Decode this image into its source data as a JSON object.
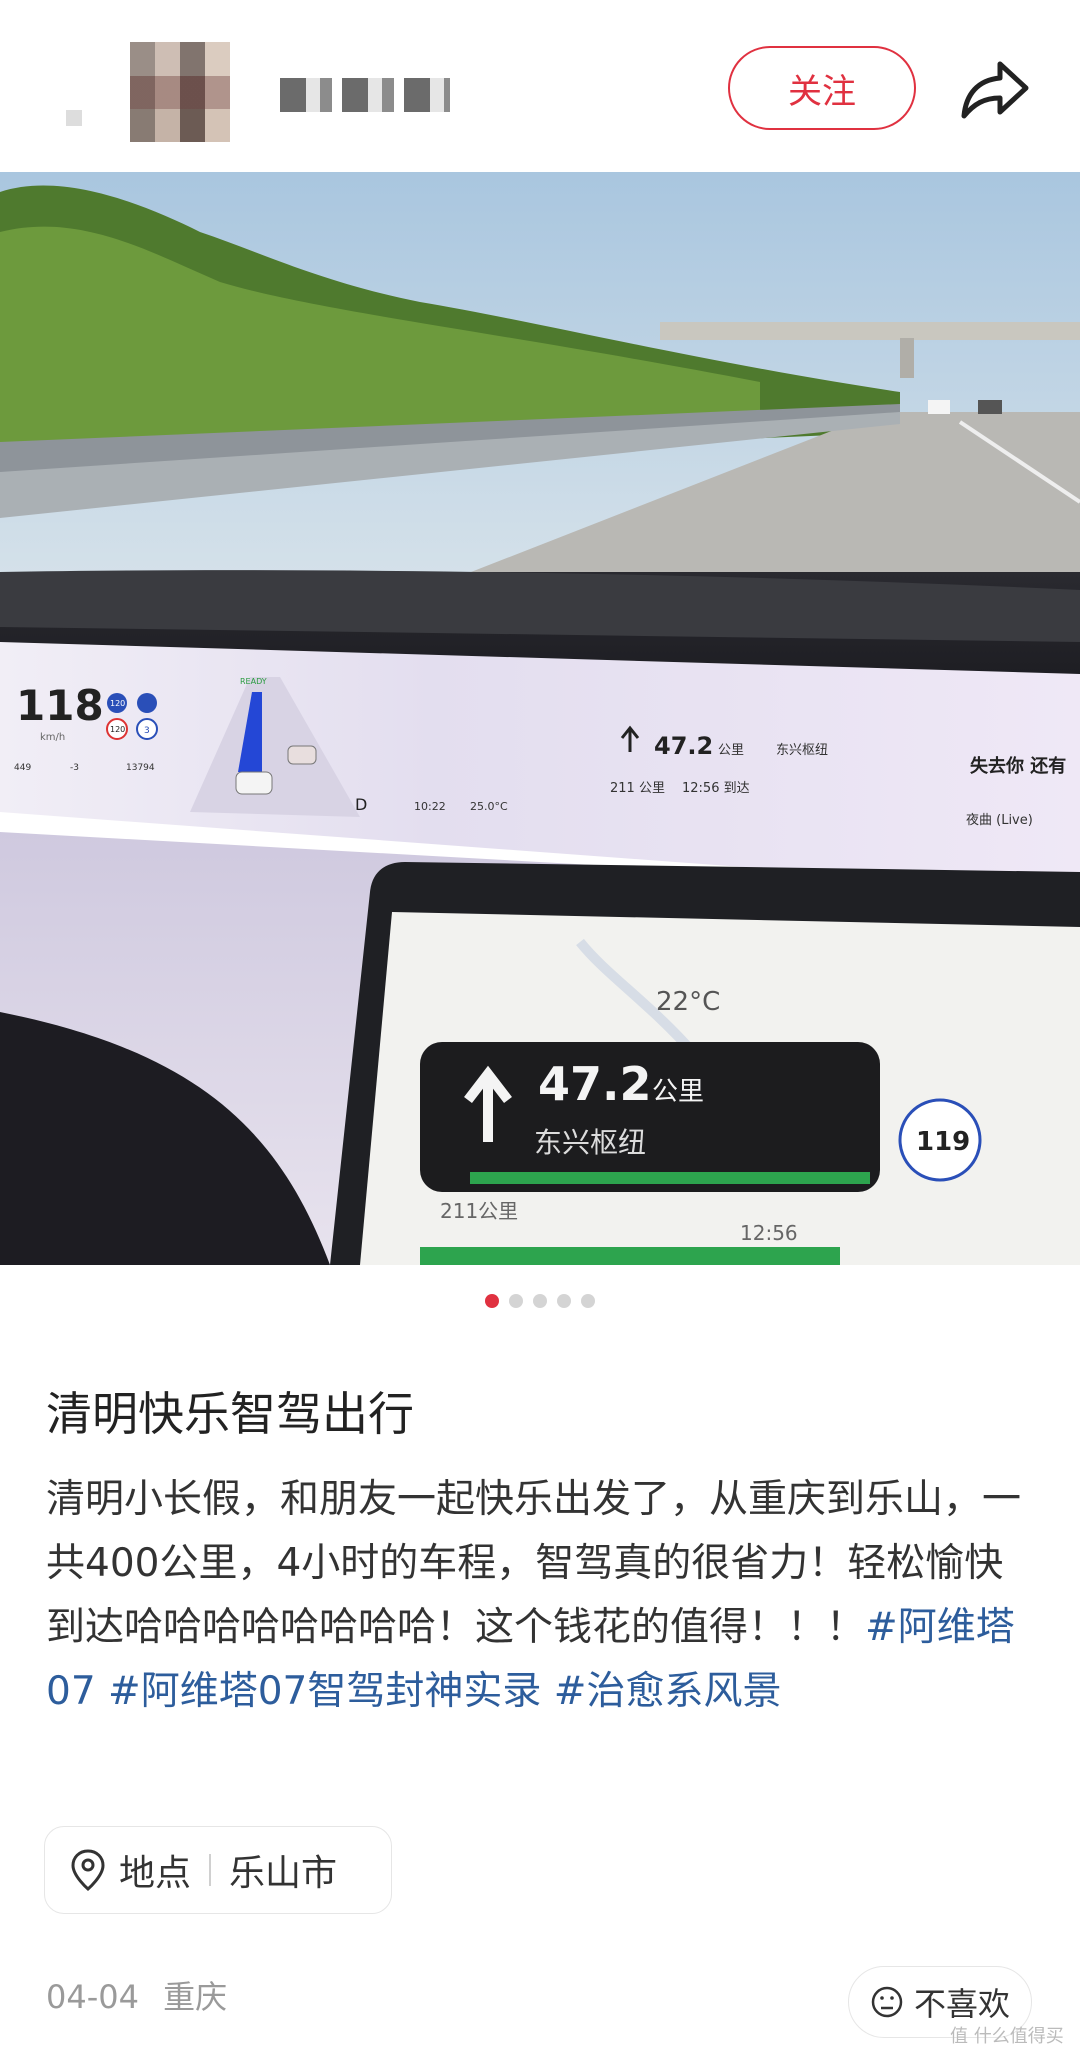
{
  "header": {
    "follow_label": "关注",
    "share_icon": "share-arrow-icon"
  },
  "media": {
    "cluster": {
      "speed": "118",
      "speed_unit": "km/h",
      "speed_limit_1": "120",
      "speed_limit_2": "120",
      "lane_num": "3",
      "ready": "READY",
      "nav_distance": "47.2",
      "nav_unit": "公里",
      "nav_road": "东兴枢纽",
      "remaining": "211 公里",
      "arrival": "12:56 到达",
      "time": "10:22",
      "temp": "25.0°C",
      "gear": "D",
      "music_title": "失去你 还有",
      "music_sub": "夜曲 (Live)",
      "stat_1": "449",
      "stat_2": "-3",
      "stat_3": "13794"
    },
    "center_screen": {
      "temp": "22°C",
      "nav_distance": "47.2",
      "nav_unit": "公里",
      "nav_road": "东兴枢纽",
      "remaining": "211公里",
      "arrival": "12:56",
      "speed_badge": "119"
    },
    "slide_index": 1,
    "slide_count": 5
  },
  "post": {
    "title": "清明快乐智驾出行",
    "body": "清明小长假，和朋友一起快乐出发了，从重庆到乐山，一共400公里，4小时的车程，智驾真的很省力！轻松愉快到达哈哈哈哈哈哈哈哈！这个钱花的值得！！！",
    "tags": [
      "#阿维塔07",
      "#阿维塔07智驾封神实录",
      "#治愈系风景"
    ],
    "location_label": "地点",
    "location_value": "乐山市",
    "date": "04-04",
    "region": "重庆",
    "dislike_label": "不喜欢"
  },
  "watermark": "值 什么值得买",
  "colors": {
    "accent": "#e03140",
    "tag": "#2d5d9c"
  }
}
